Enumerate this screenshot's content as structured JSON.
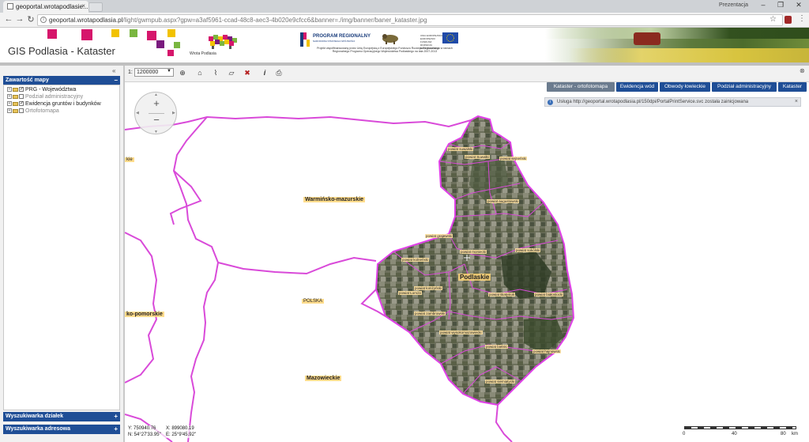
{
  "browser": {
    "tab_title": "geoportal.wrotapodlasie...",
    "tab_close": "×",
    "user": "Prezentacja",
    "url_host": "geoportal.wrotapodlasia.pl",
    "url_path": "/light/gwmpub.aspx?gpw=a3af5961-ccad-48c8-aec3-4b020e9cfcc6&banner=./img/banner/baner_kataster.jpg",
    "back_icon": "arrow-left-icon",
    "forward_icon": "arrow-right-icon",
    "reload_icon": "reload-icon"
  },
  "banner": {
    "app_title": "GIS Podlasia - Kataster",
    "logo_text": "Wrota Podlasia",
    "program_title": "PROGRAM REGIONALNY",
    "program_sub": "NARODOWA STRATEGIA SPÓJNOŚCI",
    "program_desc": "Projekt współfinansowany przez Unię Europejską z Europejskiego Funduszu Rozwoju Regionalnego w ramach Regionalnego Programu Operacyjnego Województwa Podlaskiego na lata 2007-2013",
    "eu_text": "UNIA EUROPEJSKA EUROPEJSKI FUNDUSZ ROZWOJU REGIONALNEGO",
    "colors": {
      "title_text": "#333333",
      "accent_magenta": "#d6166b",
      "accent_yellow": "#f2c200",
      "accent_green": "#7ab640"
    }
  },
  "left_panel": {
    "collapse_icon": "«",
    "map_contents_header": "Zawartość mapy",
    "map_contents_toggle": "−",
    "layers": [
      {
        "label": "PRG - Województwa",
        "checked": true,
        "enabled": true
      },
      {
        "label": "Podział administracyjny",
        "checked": false,
        "enabled": false
      },
      {
        "label": "Ewidencja gruntów i budynków",
        "checked": true,
        "enabled": true
      },
      {
        "label": "Ortofotomapa",
        "checked": false,
        "enabled": false
      }
    ],
    "parcel_search_header": "Wyszukiwarka działek",
    "address_search_header": "Wyszukiwarka adresowa",
    "search_toggle": "+"
  },
  "map_toolbar": {
    "scale_prefix": "1:",
    "scale_value": "1200000",
    "tools": [
      "zoom-in-icon",
      "locate-icon",
      "measure-line-icon",
      "measure-area-icon",
      "clear-icon",
      "info-icon",
      "print-icon"
    ],
    "collapse_icon": "»"
  },
  "map": {
    "layer_buttons": [
      {
        "label": "Kataster - ortofotomapa",
        "active": true
      },
      {
        "label": "Ewidencja wód",
        "active": false
      },
      {
        "label": "Obwody łowieckie",
        "active": false
      },
      {
        "label": "Podział administracyjny",
        "active": false
      },
      {
        "label": "Kataster",
        "active": false
      }
    ],
    "notice": "Usługa http://geoportal.wrotapodlasia.pl/150dpi/PortalPrintService.svc została zainicjowana",
    "notice_close": "×",
    "nav_zoom_in": "+",
    "nav_zoom_out": "−",
    "voivodeship_labels": {
      "warminsko": "Warmińsko-mazurskie",
      "podlaskie": "Podlaskie",
      "polska": "POLSKA",
      "mazowieckie": "Mazowieckie",
      "kujawsko": "ko-pomorskie",
      "left_cut": "kie"
    },
    "county_labels": {
      "suwalski": "powiat suwalski",
      "sejnenski": "powiat sejneński",
      "suwalki": "powiat Suwałki",
      "augustowski": "powiat augustowski",
      "grajewski": "powiat grajewski",
      "monkowski": "powiat moniecki",
      "sokolski": "powiat sokólski",
      "kolnenski": "powiat kolneński",
      "lomzynski": "powiat łomżyński",
      "lomza": "powiat Łomża",
      "bialystok": "powiat Białystok",
      "bialostocki": "powiat białostocki",
      "zambrowski": "powiat zambrowski",
      "wysokomazowiecki": "powiat wysokomazowiecki",
      "bielski": "powiat bielski",
      "hajnowski": "powiat hajnowski",
      "siemiatycki": "powiat siemiatycki"
    },
    "coords": {
      "y": "Y: 750940.76",
      "x": "X: 899080.19",
      "n": "N: 54°27'33.95\"",
      "e": "E: 25°9'45.92\""
    },
    "scale_ticks": [
      "0",
      "40",
      "80",
      "km"
    ]
  }
}
